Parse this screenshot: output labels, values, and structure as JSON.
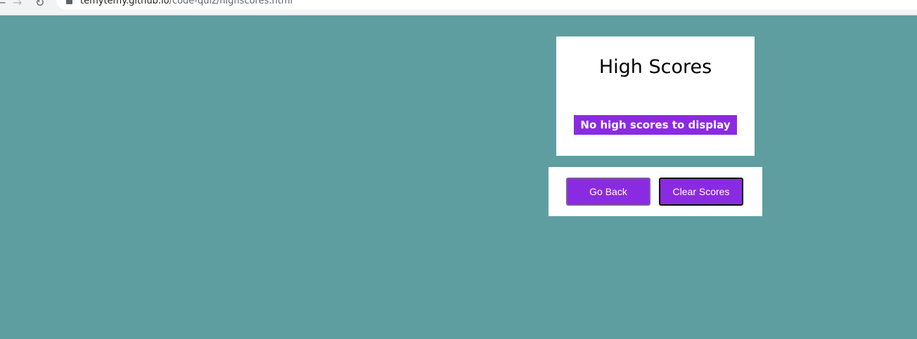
{
  "browser": {
    "url_host": "temytemy.github.io",
    "url_path": "/code-quiz/highscores.html"
  },
  "scores": {
    "title": "High Scores",
    "empty_message": "No high scores to display"
  },
  "actions": {
    "go_back_label": "Go Back",
    "clear_scores_label": "Clear Scores"
  },
  "colors": {
    "page_background": "#5f9ea0",
    "accent": "#8a2be2",
    "card_background": "#ffffff"
  }
}
